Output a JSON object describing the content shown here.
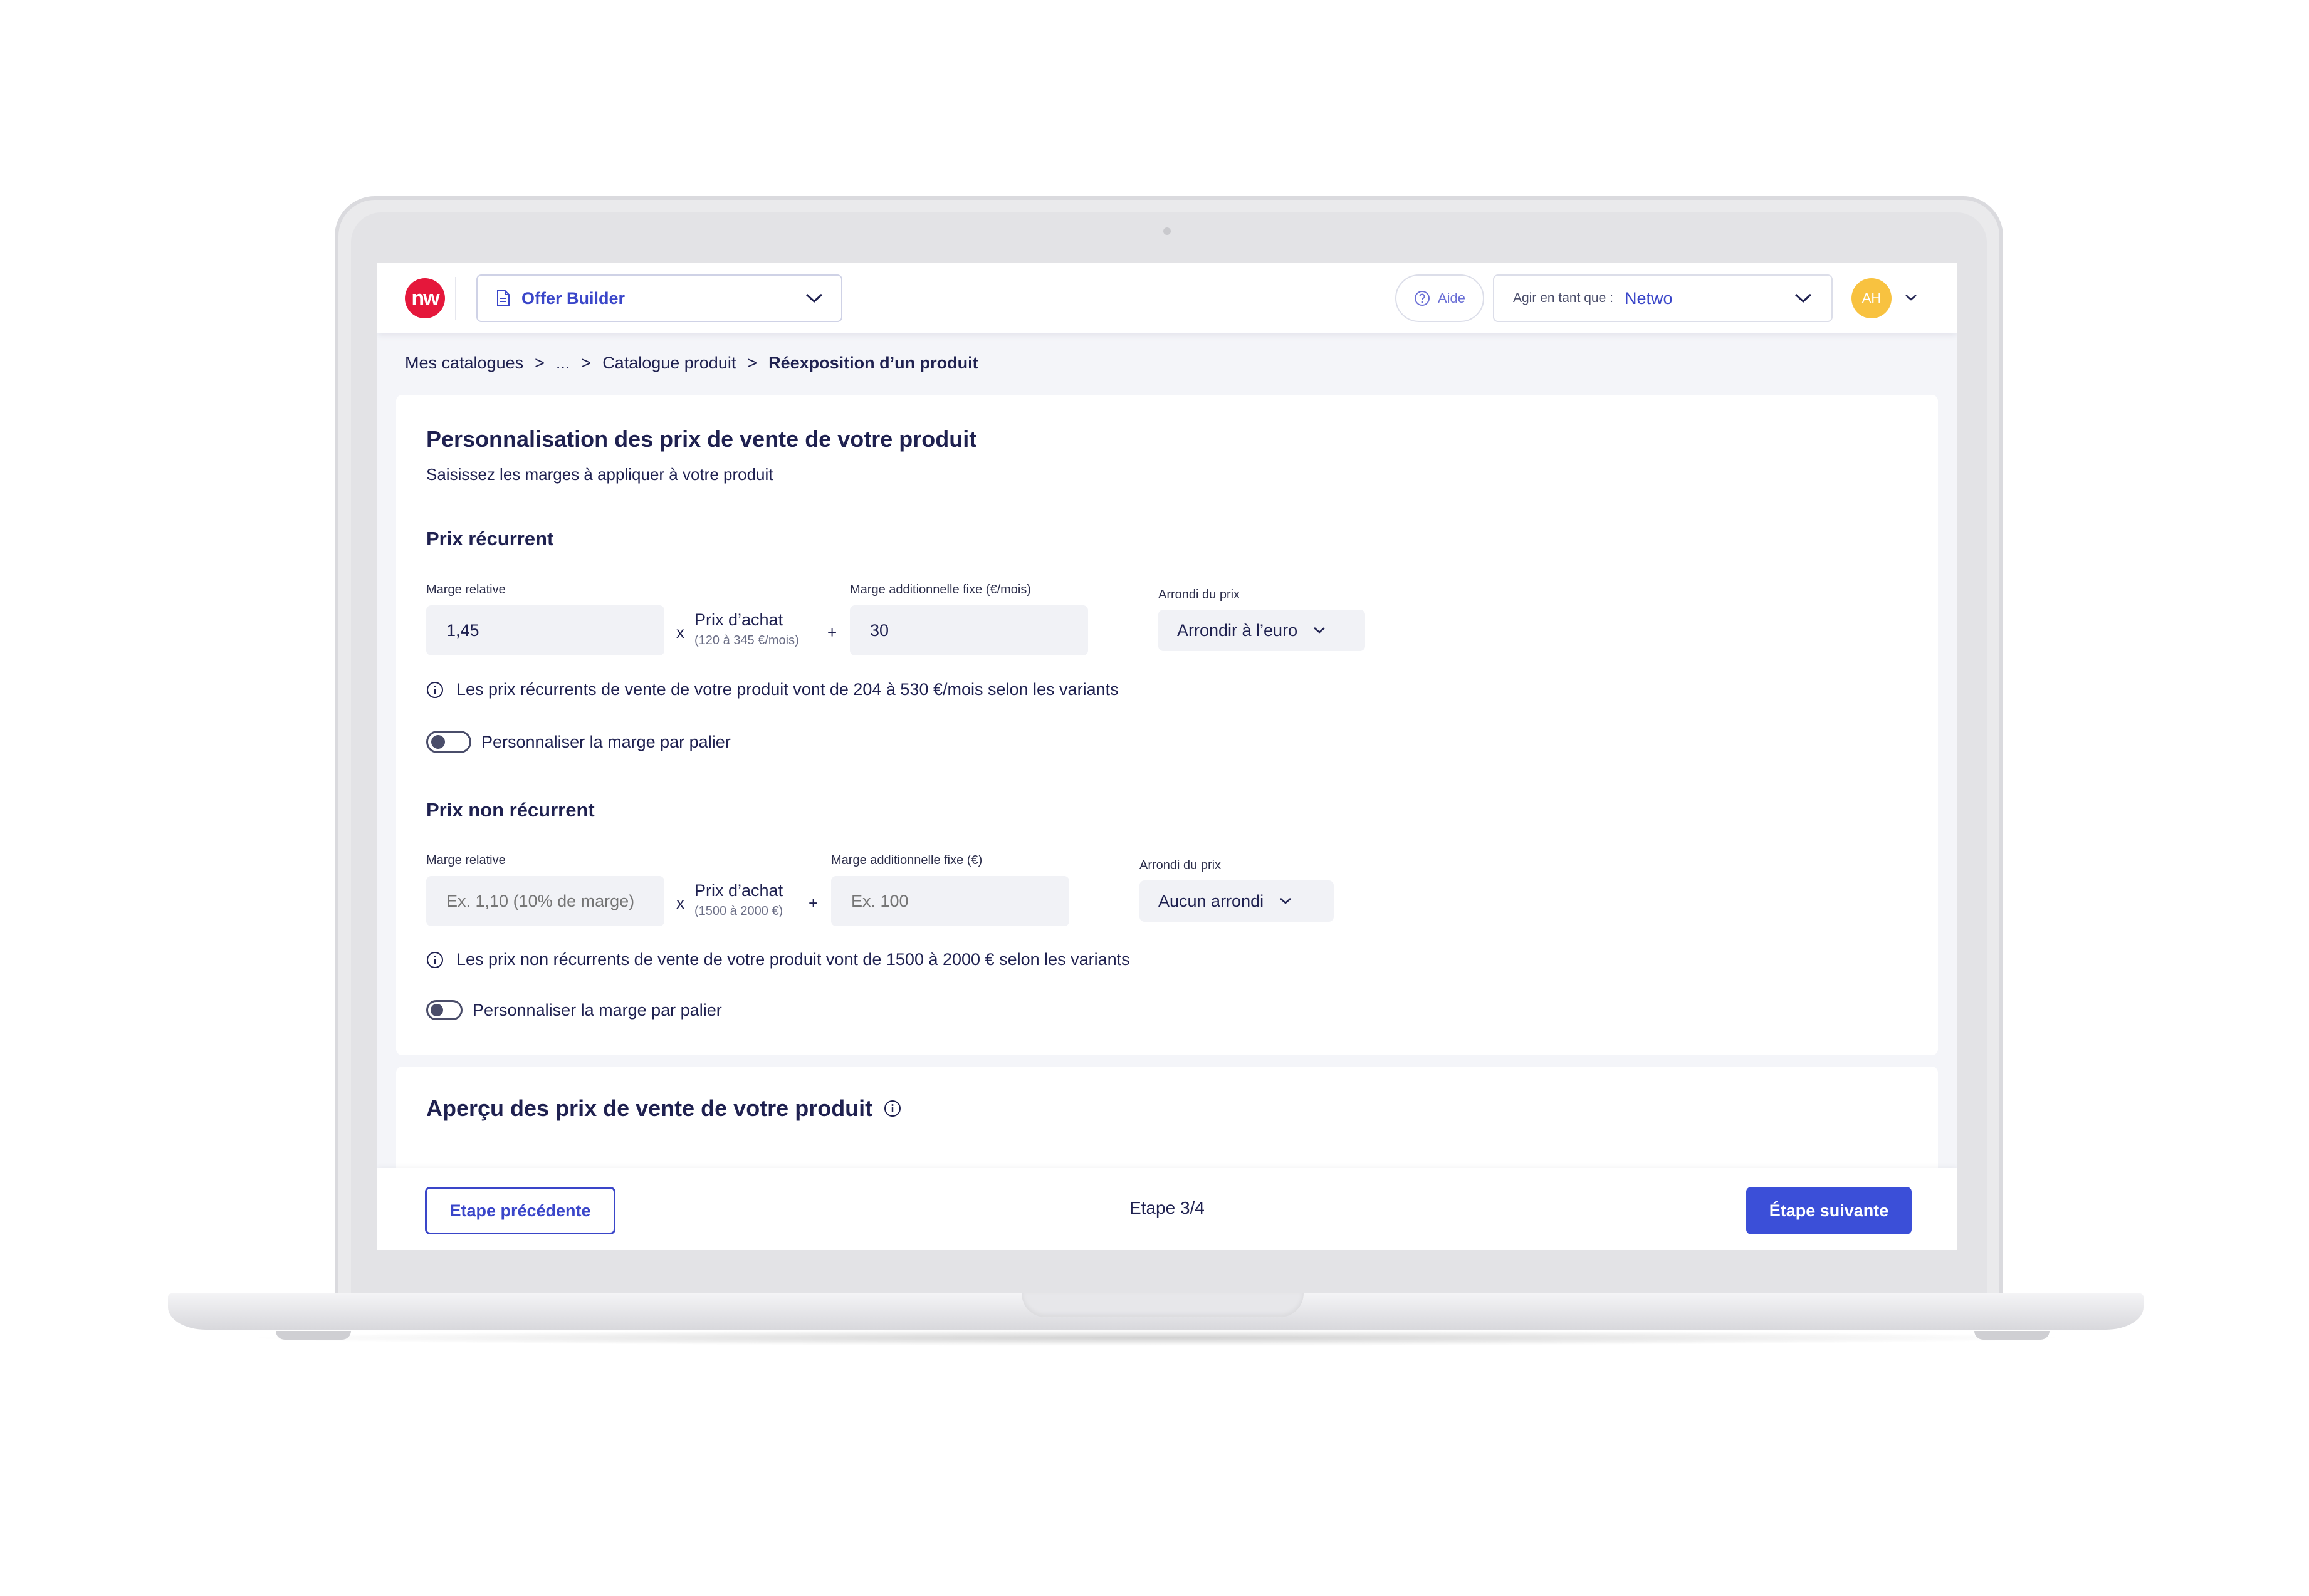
{
  "header": {
    "logo_text": "nw",
    "app_selector": "Offer Builder",
    "help_label": "Aide",
    "act_as_label": "Agir en tant que :",
    "act_as_value": "Netwo",
    "avatar_initials": "AH"
  },
  "breadcrumb": {
    "items": [
      "Mes catalogues",
      "...",
      "Catalogue produit"
    ],
    "current": "Réexposition d’un produit",
    "separator": ">"
  },
  "pricing": {
    "title": "Personnalisation des prix de vente de votre produit",
    "subtitle": "Saisissez les marges à appliquer à votre produit",
    "recurring": {
      "title": "Prix récurrent",
      "relative_margin_label": "Marge relative",
      "relative_margin_value": "1,45",
      "times": "x",
      "purchase_label": "Prix d’achat",
      "purchase_range": "(120 à 345 €/mois)",
      "plus": "+",
      "fixed_margin_label": "Marge additionnelle fixe (€/mois)",
      "fixed_margin_value": "30",
      "rounding_label": "Arrondi du prix",
      "rounding_value": "Arrondir à l’euro",
      "info": "Les prix récurrents de vente de votre produit vont de 204 à 530 €/mois selon les variants",
      "toggle_label": "Personnaliser la marge par palier"
    },
    "non_recurring": {
      "title": "Prix non récurrent",
      "relative_margin_label": "Marge relative",
      "relative_margin_placeholder": "Ex. 1,10 (10% de marge)",
      "times": "x",
      "purchase_label": "Prix d’achat",
      "purchase_range": "(1500 à 2000 €)",
      "plus": "+",
      "fixed_margin_label": "Marge additionnelle fixe (€)",
      "fixed_margin_placeholder": "Ex. 100",
      "rounding_label": "Arrondi du prix",
      "rounding_value": "Aucun arrondi",
      "info": "Les prix non récurrents de vente de votre produit vont de 1500 à 2000 € selon les variants",
      "toggle_label": "Personnaliser la marge par palier"
    }
  },
  "preview": {
    "title": "Aperçu des prix de vente de votre produit"
  },
  "footer": {
    "prev_label": "Etape précédente",
    "step_label": "Etape 3/4",
    "next_label": "Étape suivante"
  },
  "colors": {
    "primary": "#3b4fd8",
    "brand_red": "#e5173b",
    "avatar": "#f8c240",
    "text": "#1f2150"
  }
}
